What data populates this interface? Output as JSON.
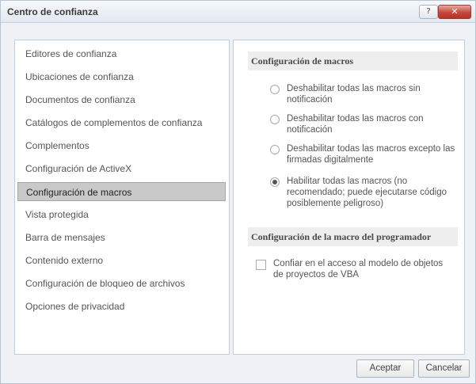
{
  "window": {
    "title": "Centro de confianza",
    "help_glyph": "?",
    "close_glyph": "✕"
  },
  "sidebar": {
    "items": [
      {
        "label": "Editores de confianza",
        "selected": false
      },
      {
        "label": "Ubicaciones de confianza",
        "selected": false
      },
      {
        "label": "Documentos de confianza",
        "selected": false
      },
      {
        "label": "Catálogos de complementos de confianza",
        "selected": false
      },
      {
        "label": "Complementos",
        "selected": false
      },
      {
        "label": "Configuración de ActiveX",
        "selected": false
      },
      {
        "label": "Configuración de macros",
        "selected": true
      },
      {
        "label": "Vista protegida",
        "selected": false
      },
      {
        "label": "Barra de mensajes",
        "selected": false
      },
      {
        "label": "Contenido externo",
        "selected": false
      },
      {
        "label": "Configuración de bloqueo de archivos",
        "selected": false
      },
      {
        "label": "Opciones de privacidad",
        "selected": false
      }
    ]
  },
  "macros": {
    "heading": "Configuración de macros",
    "options": [
      {
        "label": "Deshabilitar todas las macros sin notificación",
        "selected": false
      },
      {
        "label": "Deshabilitar todas las macros con notificación",
        "selected": false
      },
      {
        "label": "Deshabilitar todas las macros excepto las firmadas digitalmente",
        "selected": false
      },
      {
        "label": "Habilitar todas las macros (no recomendado; puede ejecutarse código posiblemente peligroso)",
        "selected": true
      }
    ]
  },
  "developer": {
    "heading": "Configuración de la macro del programador",
    "checkbox_label": "Confiar en el acceso al modelo de objetos de proyectos de VBA",
    "checked": false
  },
  "footer": {
    "ok_label": "Aceptar",
    "cancel_label": "Cancelar"
  }
}
